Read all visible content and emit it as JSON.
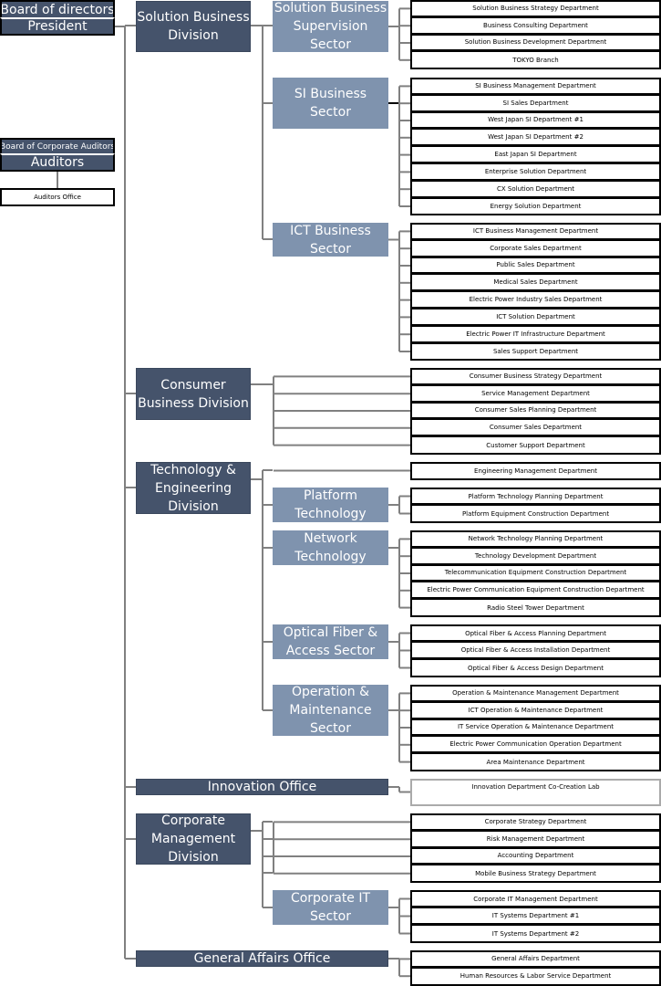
{
  "executives": {
    "board": "Board of directors",
    "president": "President",
    "board_auditors": "Board of Corporate Auditors",
    "auditors": "Auditors",
    "auditors_office": "Auditors Office"
  },
  "divisions": [
    {
      "name": "Solution Business Division"
    },
    {
      "name": "Consumer Business Division"
    },
    {
      "name": "Technology & Engineering Division"
    },
    {
      "name": "Innovation Office"
    },
    {
      "name": "Corporate Management Division"
    },
    {
      "name": "General Affairs Office"
    }
  ],
  "sectors": [
    {
      "name": "Solution Business Supervision Sector"
    },
    {
      "name": "SI Business Sector"
    },
    {
      "name": "ICT Business Sector"
    },
    {
      "name": "Platform Technology"
    },
    {
      "name": "Network Technology"
    },
    {
      "name": "Optical Fiber & Access Sector"
    },
    {
      "name": "Operation & Maintenance Sector"
    },
    {
      "name": "Corporate IT Sector"
    }
  ],
  "department_groups": [
    {
      "departments": [
        "Solution Business Strategy Department",
        "Business Consulting Department",
        "Solution Business Development Department",
        "TOKYO Branch"
      ]
    },
    {
      "departments": [
        "SI Business Management Department",
        "SI Sales Department",
        "West Japan SI Department #1",
        "West Japan SI Department #2",
        "East Japan SI Department",
        "Enterprise Solution Department",
        "CX Solution Department",
        "Energy Solution Department"
      ]
    },
    {
      "departments": [
        "ICT Business Management Department",
        "Corporate Sales Department",
        "Public Sales Department",
        "Medical Sales Department",
        "Electric Power Industry Sales Department",
        "ICT Solution Department",
        "Electric Power IT Infrastructure Department",
        "Sales Support Department"
      ]
    },
    {
      "departments": [
        "Consumer Business Strategy Department",
        "Service Management Department",
        "Consumer Sales Planning Department",
        "Consumer Sales Department",
        "Customer Support Department"
      ]
    },
    {
      "departments": [
        "Engineering Management Department"
      ]
    },
    {
      "departments": [
        "Platform Technology Planning Department",
        "Platform Equipment Construction Department"
      ]
    },
    {
      "departments": [
        "Network Technology Planning Department",
        "Technology Development Department",
        "Telecommunication Equipment Construction Department",
        "Electric Power Communication Equipment Construction Department",
        "Radio Steel Tower Department"
      ]
    },
    {
      "departments": [
        "Optical Fiber & Access Planning Department",
        "Optical Fiber & Access Installation Department",
        "Optical Fiber & Access Design Department"
      ]
    },
    {
      "departments": [
        "Operation & Maintenance Management Department",
        "ICT Operation & Maintenance Department",
        "IT Service Operation & Maintenance Department",
        "Electric Power Communication Operation Department",
        "Area Maintenance Department"
      ]
    },
    {
      "departments": [
        "Innovation Department Co-Creation Lab"
      ]
    },
    {
      "departments": [
        "Corporate Strategy Department",
        "Risk Management Department",
        "Accounting Department",
        "Mobile Business Strategy Department"
      ]
    },
    {
      "departments": [
        "Corporate IT Management Department",
        "IT Systems Department #1",
        "IT Systems Department #2"
      ]
    },
    {
      "departments": [
        "General Affairs Department",
        "Human Resources & Labor Service Department"
      ]
    }
  ],
  "colors": {
    "division": "#45536b",
    "sector": "#7f93ae",
    "line": "#808080",
    "department_border": "#000000"
  }
}
